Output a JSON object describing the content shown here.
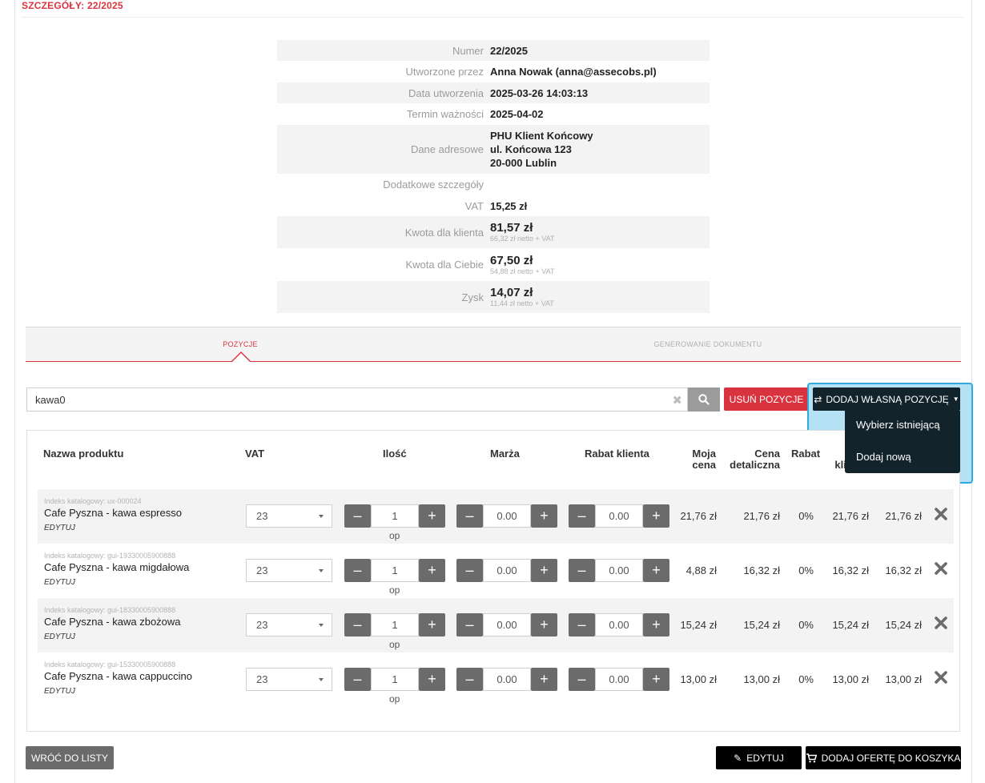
{
  "header": {
    "title": "SZCZEGÓŁY: 22/2025"
  },
  "details": {
    "numer_label": "Numer",
    "numer": "22/2025",
    "created_by_label": "Utworzone przez",
    "created_by": "Anna Nowak (anna@assecobs.pl)",
    "created_date_label": "Data utworzenia",
    "created_date": "2025-03-26 14:03:13",
    "expiry_label": "Termin ważności",
    "expiry": "2025-04-02",
    "address_label": "Dane adresowe",
    "address_line1": "PHU Klient Końcowy",
    "address_line2": "ul. Końcowa 123",
    "address_line3": "20-000 Lublin",
    "extra_label": "Dodatkowe szczegóły",
    "extra": "",
    "vat_label": "VAT",
    "vat": "15,25 zł",
    "client_amount_label": "Kwota dla klienta",
    "client_amount": "81,57 zł",
    "client_amount_net": "66,32 zł netto + VAT",
    "your_amount_label": "Kwota dla Ciebie",
    "your_amount": "67,50 zł",
    "your_amount_net": "54,88 zł netto + VAT",
    "profit_label": "Zysk",
    "profit": "14,07 zł",
    "profit_net": "11,44 zł netto + VAT"
  },
  "tabs": [
    {
      "label": "POZYCJE",
      "active": true
    },
    {
      "label": "GENEROWANIE DOKUMENTU",
      "active": false
    }
  ],
  "search": {
    "value": "kawa0"
  },
  "actions": {
    "delete_label": "USUŃ POZYCJE",
    "add_own_label": "DODAJ WŁASNĄ POZYCJĘ",
    "dropdown": [
      "Wybierz istniejącą",
      "Dodaj nową"
    ]
  },
  "table": {
    "headers": {
      "name": "Nazwa produktu",
      "vat": "VAT",
      "qty": "Ilość",
      "margin": "Marża",
      "discount": "Rabat klienta",
      "my_price_1": "Moja",
      "my_price_2": "cena",
      "retail_1": "Cena",
      "retail_2": "detaliczna",
      "rabat": "Rabat",
      "client_1": "C",
      "client_2": "klienta"
    },
    "rows": [
      {
        "index": "Indeks katalogowy: ux-000024",
        "name": "Cafe Pyszna - kawa espresso",
        "edit": "EDYTUJ",
        "vat": "23",
        "qty": "1",
        "unit": "op",
        "margin": "0.00",
        "discount": "0.00",
        "my_price": "21,76 zł",
        "retail": "21,76 zł",
        "rabat": "0%",
        "client_price": "21,76 zł",
        "total": "21,76 zł"
      },
      {
        "index": "Indeks katalogowy: gui-19330005900888",
        "name": "Cafe Pyszna - kawa migdałowa",
        "edit": "EDYTUJ",
        "vat": "23",
        "qty": "1",
        "unit": "op",
        "margin": "0.00",
        "discount": "0.00",
        "my_price": "4,88 zł",
        "retail": "16,32 zł",
        "rabat": "0%",
        "client_price": "16,32 zł",
        "total": "16,32 zł"
      },
      {
        "index": "Indeks katalogowy: gui-18330005900888",
        "name": "Cafe Pyszna - kawa zbożowa",
        "edit": "EDYTUJ",
        "vat": "23",
        "qty": "1",
        "unit": "op",
        "margin": "0.00",
        "discount": "0.00",
        "my_price": "15,24 zł",
        "retail": "15,24 zł",
        "rabat": "0%",
        "client_price": "15,24 zł",
        "total": "15,24 zł"
      },
      {
        "index": "Indeks katalogowy: gui-15330005900888",
        "name": "Cafe Pyszna - kawa cappuccino",
        "edit": "EDYTUJ",
        "vat": "23",
        "qty": "1",
        "unit": "op",
        "margin": "0.00",
        "discount": "0.00",
        "my_price": "13,00 zł",
        "retail": "13,00 zł",
        "rabat": "0%",
        "client_price": "13,00 zł",
        "total": "13,00 zł"
      }
    ]
  },
  "footer": {
    "back_label": "WRÓĆ DO LISTY",
    "edit_label": "EDYTUJ",
    "add_cart_label": "DODAJ OFERTĘ DO KOSZYKA"
  },
  "colors": {
    "accent": "#d9333f",
    "dark": "#13232b",
    "highlight": "#2fa9e0"
  }
}
